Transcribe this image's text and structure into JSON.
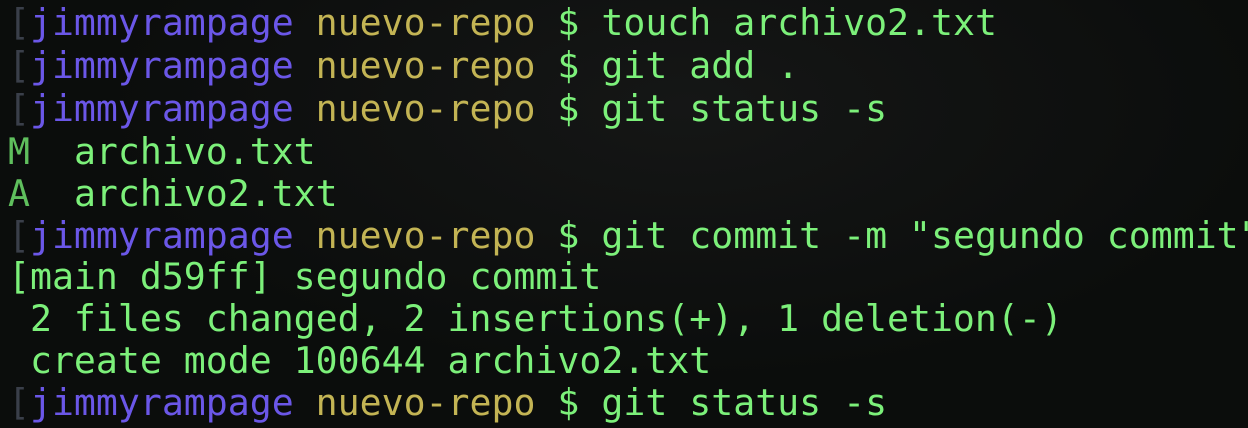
{
  "prompt": {
    "bracket": "[",
    "user": "jimmyrampage",
    "repo": "nuevo-repo",
    "symbol": "$"
  },
  "lines": [
    {
      "type": "prompt",
      "command": "touch archivo2.txt"
    },
    {
      "type": "prompt",
      "command": "git add ."
    },
    {
      "type": "prompt",
      "command": "git status -s"
    },
    {
      "type": "status",
      "code": "M",
      "file": "archivo.txt"
    },
    {
      "type": "status",
      "code": "A",
      "file": "archivo2.txt"
    },
    {
      "type": "prompt",
      "command": "git commit -m \"segundo commit\""
    },
    {
      "type": "output",
      "text": "[main d59ff] segundo commit"
    },
    {
      "type": "output",
      "text": " 2 files changed, 2 insertions(+), 1 deletion(-)"
    },
    {
      "type": "output",
      "text": " create mode 100644 archivo2.txt"
    },
    {
      "type": "prompt",
      "command": "git status -s"
    }
  ],
  "colors": {
    "background": "#0b0d0c",
    "user": "#6b57e8",
    "repo": "#c3b454",
    "command": "#7cf07a",
    "status_code": "#5fbf5d"
  }
}
